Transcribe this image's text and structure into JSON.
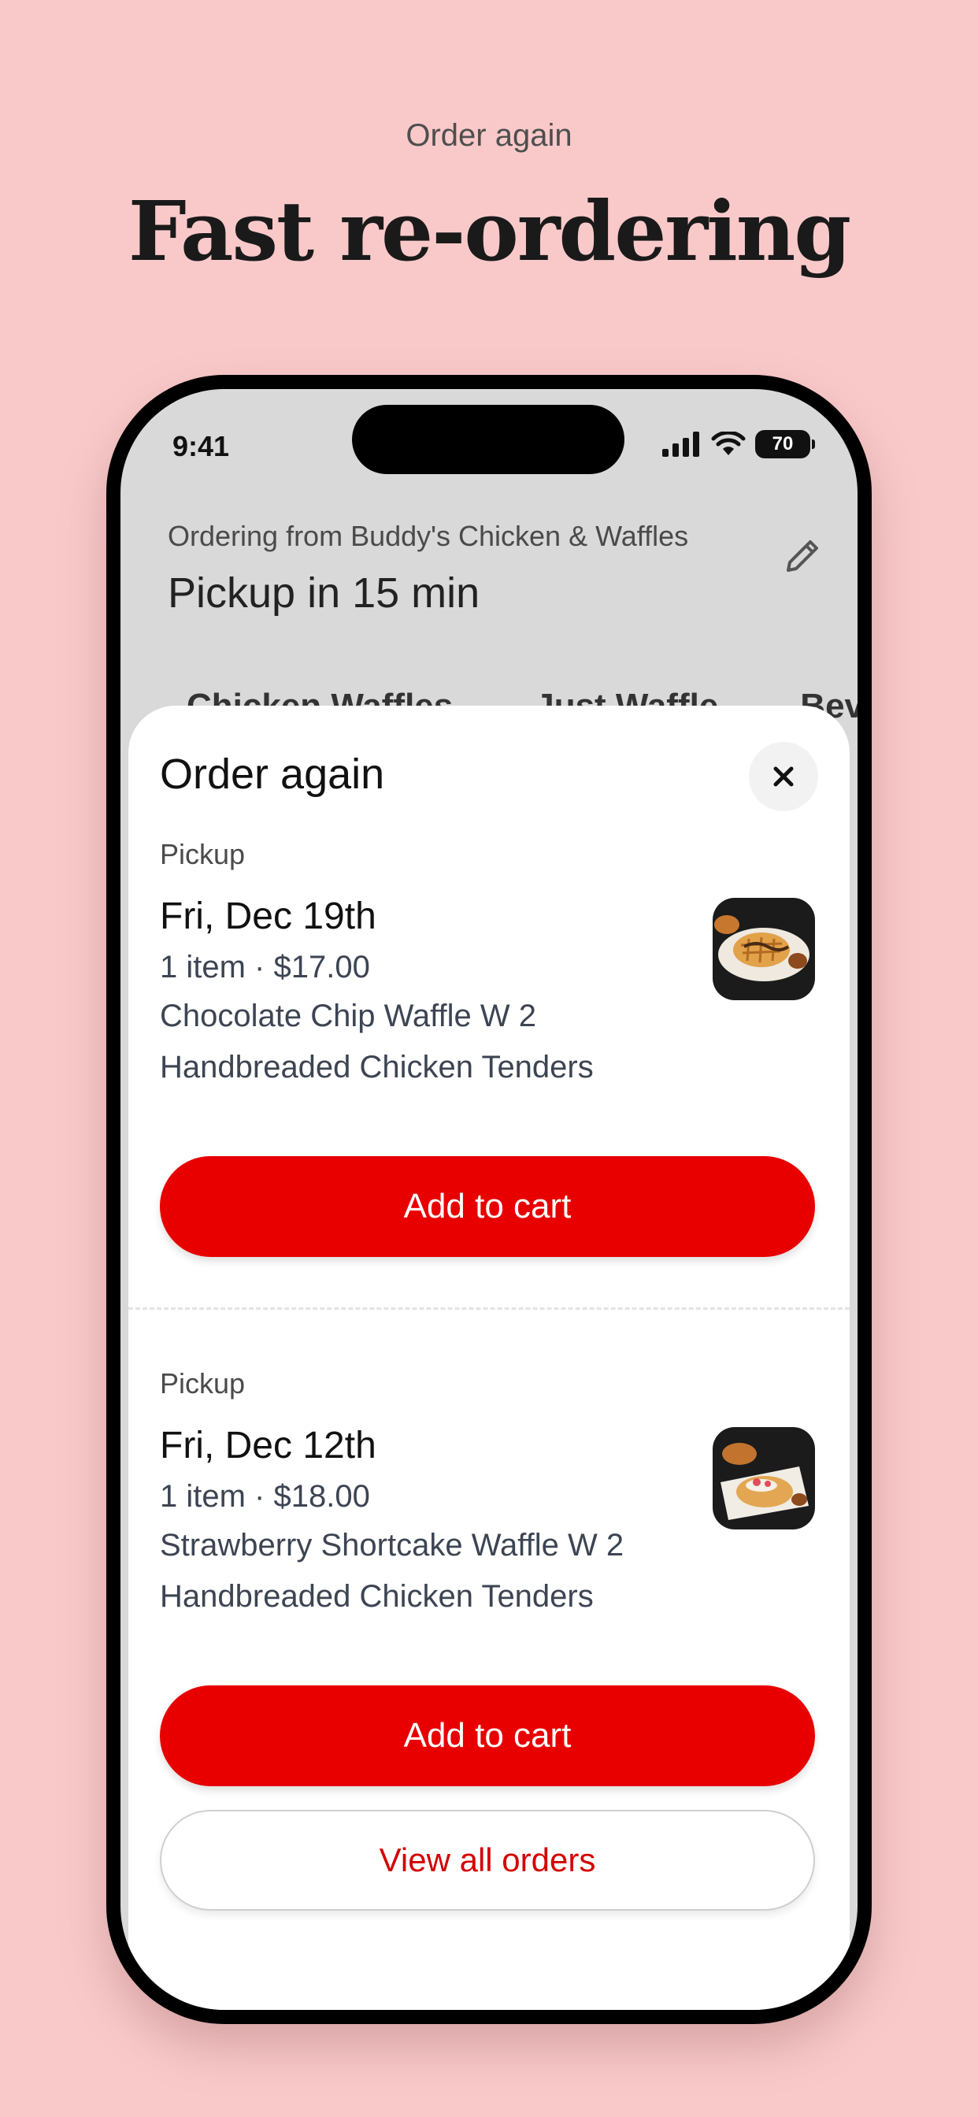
{
  "promo": {
    "eyebrow": "Order again",
    "headline": "Fast re-ordering"
  },
  "status_bar": {
    "time": "9:41",
    "battery": "70"
  },
  "header": {
    "ordering_from": "Ordering from Buddy's Chicken & Waffles",
    "pickup_time": "Pickup in 15 min",
    "edit_icon": "pencil-icon"
  },
  "categories": [
    "Chicken Waffles",
    "Just Waffle",
    "Beve"
  ],
  "sheet": {
    "title": "Order again",
    "close_icon": "close-icon",
    "orders": [
      {
        "type": "Pickup",
        "date": "Fri, Dec 19th",
        "meta": "1 item · $17.00",
        "description": "Chocolate Chip Waffle W 2 Handbreaded Chicken Tenders",
        "button": "Add to cart"
      },
      {
        "type": "Pickup",
        "date": "Fri, Dec 12th",
        "meta": "1 item · $18.00",
        "description": "Strawberry Shortcake Waffle W 2 Handbreaded Chicken Tenders",
        "button": "Add to cart"
      }
    ],
    "view_all": "View all orders"
  },
  "colors": {
    "background": "#f9c9c9",
    "accent": "#e80000",
    "accent_text": "#d40000"
  }
}
